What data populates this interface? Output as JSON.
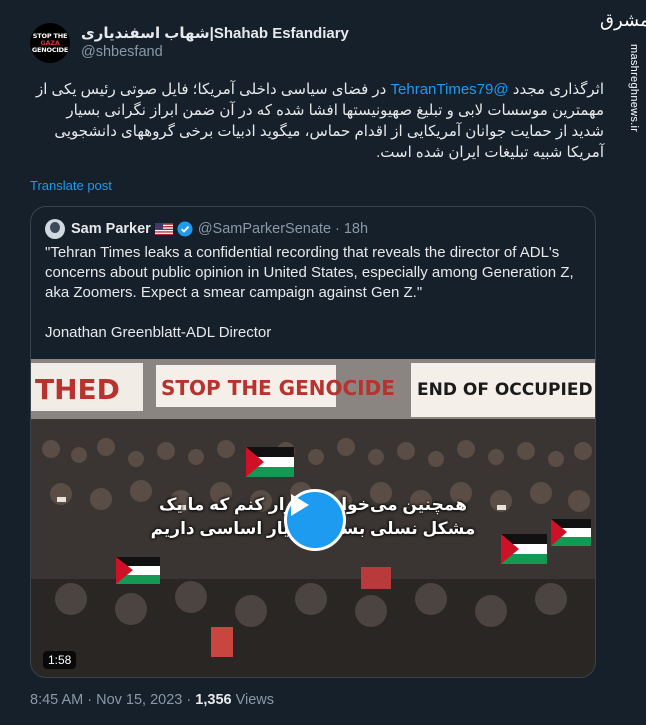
{
  "author": {
    "avatar_text_lines": [
      "STOP THE",
      "GAZA",
      "GENOCIDE"
    ],
    "name_persian": "شهاب اسفندیاری",
    "name_latin": "Shahab Esfandiary",
    "handle": "@shbesfand"
  },
  "watermark": {
    "logo_text": "مشرق",
    "site": "mashreghnews.ir"
  },
  "tweet": {
    "text_before_mention": "اثرگذاری مجدد",
    "mention": "@TehranTimes79",
    "text_after_mention": "در فضای سیاسی داخلی آمریکا؛ فایل صوتی رئیس یکی از مهمترین موسسات لابی و تبلیغ صهیونیستها افشا شده که در آن ضمن ابراز نگرانی بسیار شدید از حمایت جوانان آمریکایی از اقدام حماس، میگوید ادبیات برخی گروههای دانشجویی آمریکا شبیه تبلیغات ایران شده است.",
    "translate_label": "Translate post"
  },
  "quoted": {
    "name": "Sam Parker",
    "handle": "@SamParkerSenate",
    "separator": "·",
    "time": "18h",
    "text": "\"Tehran Times leaks a confidential recording that reveals the director of ADL's concerns about public opinion in United States, especially among Generation Z, aka Zoomers. Expect a smear campaign against Gen Z.\"",
    "signature": "Jonathan Greenblatt-ADL Director",
    "video": {
      "banner_left": "STOP THE GENOCIDE",
      "banner_left_partial": "THED",
      "banner_right": "END OF OCCUPIED",
      "subtitle_line1": "همچنین می‌خواهم تکرار کنم که ما یک",
      "subtitle_line2": "مشکل نسلی بسیار بسیار اساسی داریم",
      "duration": "1:58"
    }
  },
  "meta": {
    "time": "8:45 AM",
    "separator": "·",
    "date": "Nov 15, 2023",
    "views_count": "1,356",
    "views_label": "Views"
  },
  "colors": {
    "background": "#15202b",
    "accent": "#1d9bf0",
    "muted": "#8b98a5",
    "border": "#38444d"
  }
}
